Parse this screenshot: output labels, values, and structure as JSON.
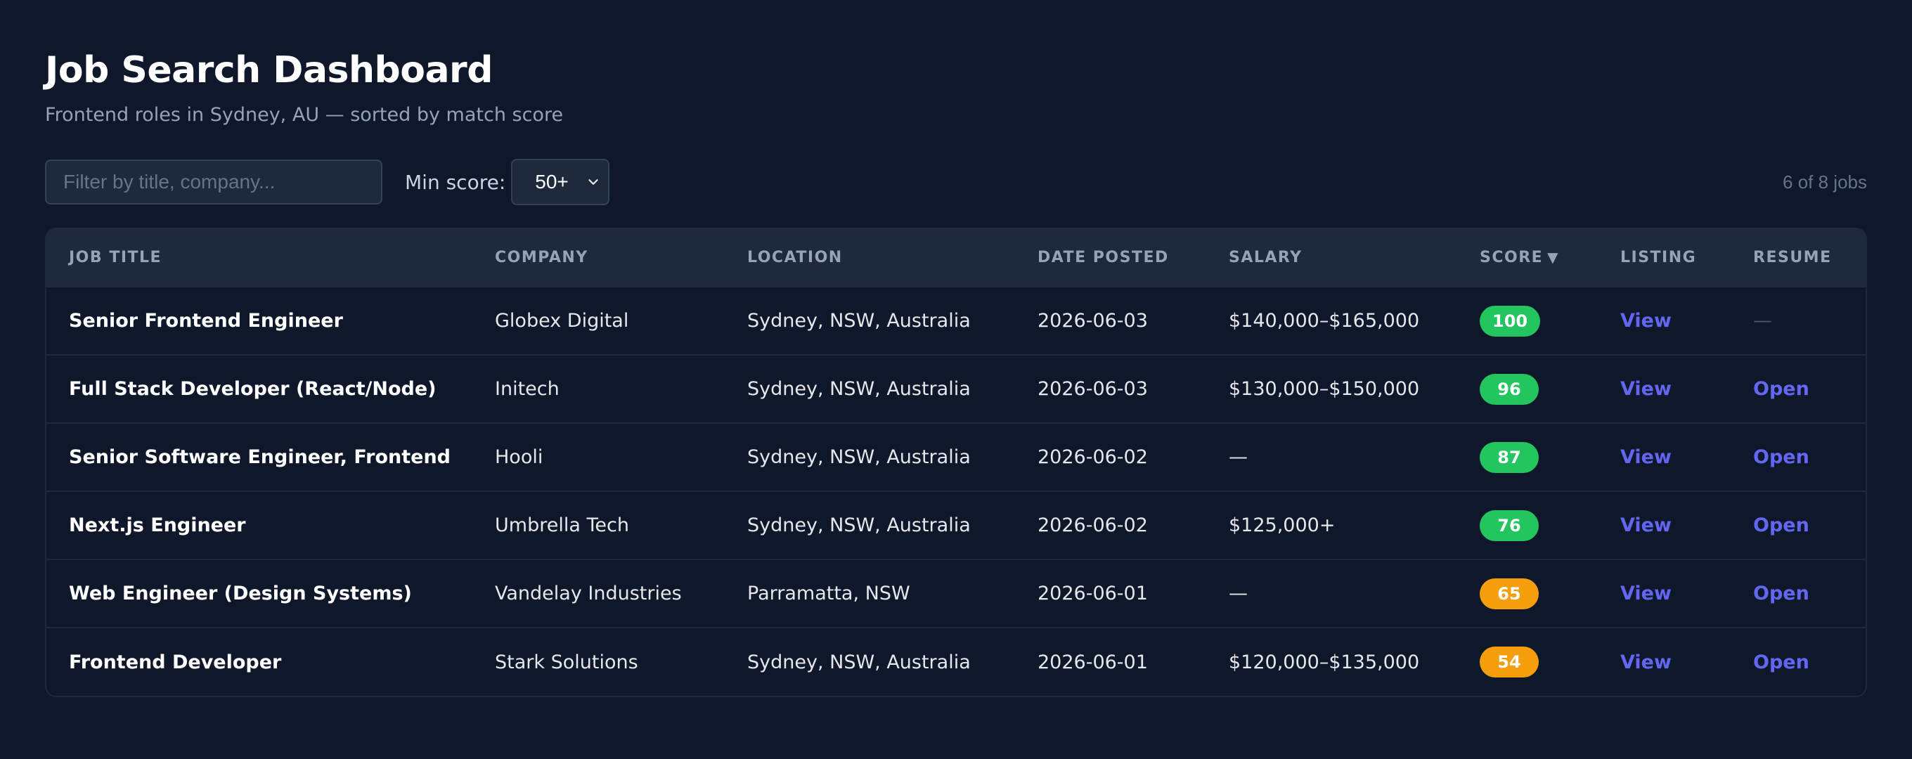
{
  "header": {
    "title": "Job Search Dashboard",
    "subtitle": "Frontend roles in Sydney, AU — sorted by match score"
  },
  "controls": {
    "filter_placeholder": "Filter by title, company...",
    "min_score_label": "Min score:",
    "min_score_value": "50+",
    "job_count": "6 of 8 jobs"
  },
  "table": {
    "columns": {
      "title": "Job Title",
      "company": "Company",
      "location": "Location",
      "date_posted": "Date Posted",
      "salary": "Salary",
      "score": "Score",
      "score_sort_indicator": "▼",
      "listing": "Listing",
      "resume": "Resume"
    },
    "rows": [
      {
        "title": "Senior Frontend Engineer",
        "company": "Globex Digital",
        "location": "Sydney, NSW, Australia",
        "date": "2026-06-03",
        "salary": "$140,000–$165,000",
        "score": "100",
        "score_color": "#22c55e",
        "listing": "View",
        "resume": "—"
      },
      {
        "title": "Full Stack Developer (React/Node)",
        "company": "Initech",
        "location": "Sydney, NSW, Australia",
        "date": "2026-06-03",
        "salary": "$130,000–$150,000",
        "score": "96",
        "score_color": "#22c55e",
        "listing": "View",
        "resume": "Open"
      },
      {
        "title": "Senior Software Engineer, Frontend",
        "company": "Hooli",
        "location": "Sydney, NSW, Australia",
        "date": "2026-06-02",
        "salary": "—",
        "score": "87",
        "score_color": "#22c55e",
        "listing": "View",
        "resume": "Open"
      },
      {
        "title": "Next.js Engineer",
        "company": "Umbrella Tech",
        "location": "Sydney, NSW, Australia",
        "date": "2026-06-02",
        "salary": "$125,000+",
        "score": "76",
        "score_color": "#22c55e",
        "listing": "View",
        "resume": "Open"
      },
      {
        "title": "Web Engineer (Design Systems)",
        "company": "Vandelay Industries",
        "location": "Parramatta, NSW",
        "date": "2026-06-01",
        "salary": "—",
        "score": "65",
        "score_color": "#f59e0b",
        "listing": "View",
        "resume": "Open"
      },
      {
        "title": "Frontend Developer",
        "company": "Stark Solutions",
        "location": "Sydney, NSW, Australia",
        "date": "2026-06-01",
        "salary": "$120,000–$135,000",
        "score": "54",
        "score_color": "#f59e0b",
        "listing": "View",
        "resume": "Open"
      }
    ]
  },
  "icons": {
    "select_chevron": "chevron-down-icon"
  },
  "colors": {
    "background": "#0f172a",
    "surface": "#1e293b",
    "accent_link": "#6366f1",
    "score_high": "#22c55e",
    "score_mid": "#f59e0b"
  }
}
